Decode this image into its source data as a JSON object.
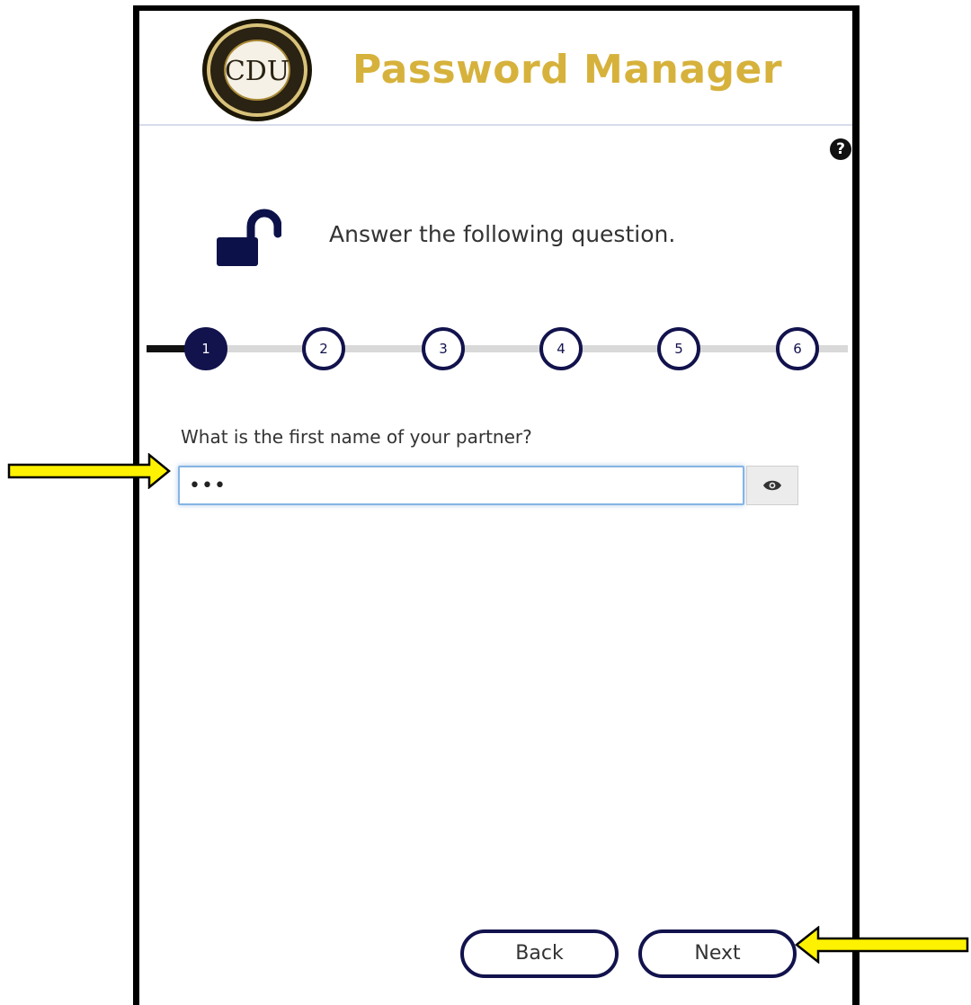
{
  "header": {
    "logo_text": "CDU",
    "title": "Password Manager"
  },
  "help": {
    "icon": "question-icon",
    "glyph": "?"
  },
  "prompt": {
    "icon": "unlock-icon",
    "text": "Answer the following question."
  },
  "steps": {
    "items": [
      "1",
      "2",
      "3",
      "4",
      "5",
      "6"
    ],
    "current": 1
  },
  "question": {
    "label": "What is the first name of your partner?",
    "value": "•••",
    "reveal_icon": "eye-icon"
  },
  "buttons": {
    "back": "Back",
    "next": "Next"
  },
  "annotations": {
    "arrow_color": "#fff200",
    "arrow_icon": "arrow-right-icon"
  },
  "colors": {
    "title": "#d6b23c",
    "accent": "#12124d"
  }
}
